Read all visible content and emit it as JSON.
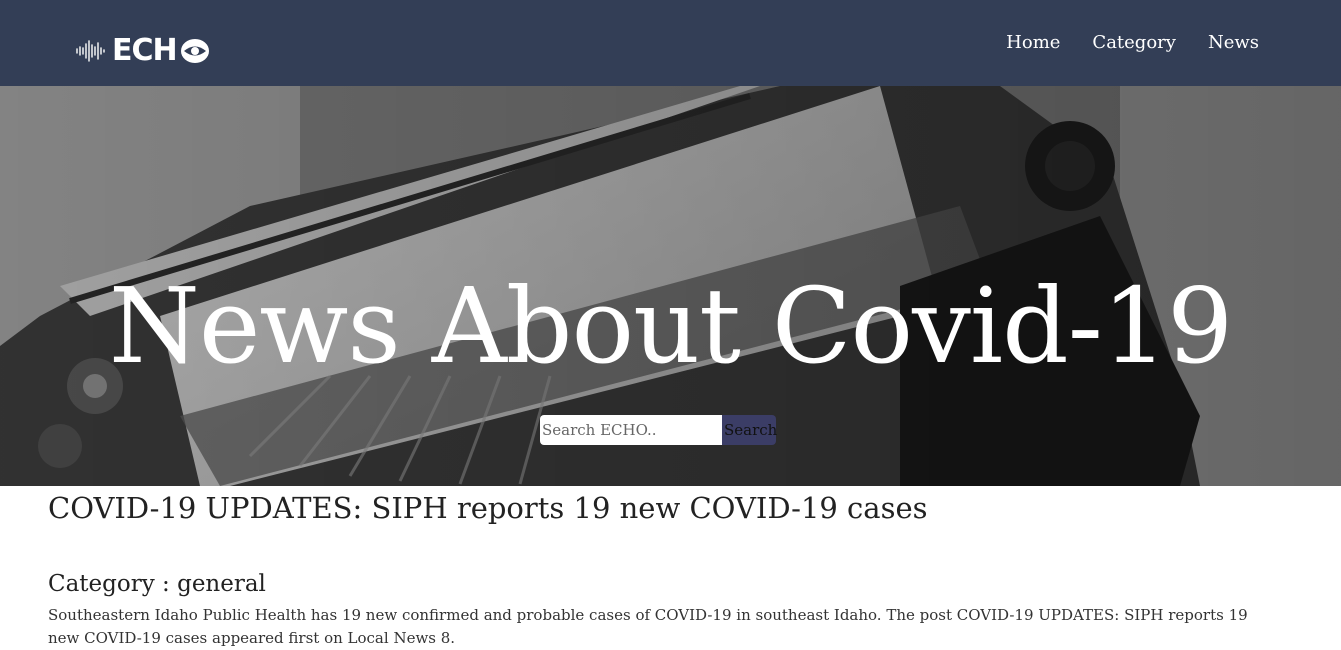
{
  "brand": {
    "name": "ECH",
    "icon": "soundwave-icon",
    "eye_icon": "eye-icon"
  },
  "nav": {
    "items": [
      {
        "label": "Home"
      },
      {
        "label": "Category"
      },
      {
        "label": "News"
      }
    ]
  },
  "hero": {
    "title": "News About Covid-19",
    "background_icon": "typewriter-news-photo",
    "search": {
      "placeholder": "Search ECHO..",
      "value": "",
      "button_label": "Search"
    }
  },
  "article": {
    "title": "COVID-19 UPDATES: SIPH reports 19 new COVID-19 cases",
    "category": "Category : general",
    "body": "Southeastern Idaho Public Health has 19 new confirmed and probable cases of COVID-19 in southeast Idaho. The post COVID-19 UPDATES: SIPH reports 19 new COVID-19 cases appeared first on Local News 8."
  },
  "colors": {
    "navbar_bg": "#333e56",
    "search_button_bg": "#3b3d66",
    "text_dark": "#222222"
  }
}
